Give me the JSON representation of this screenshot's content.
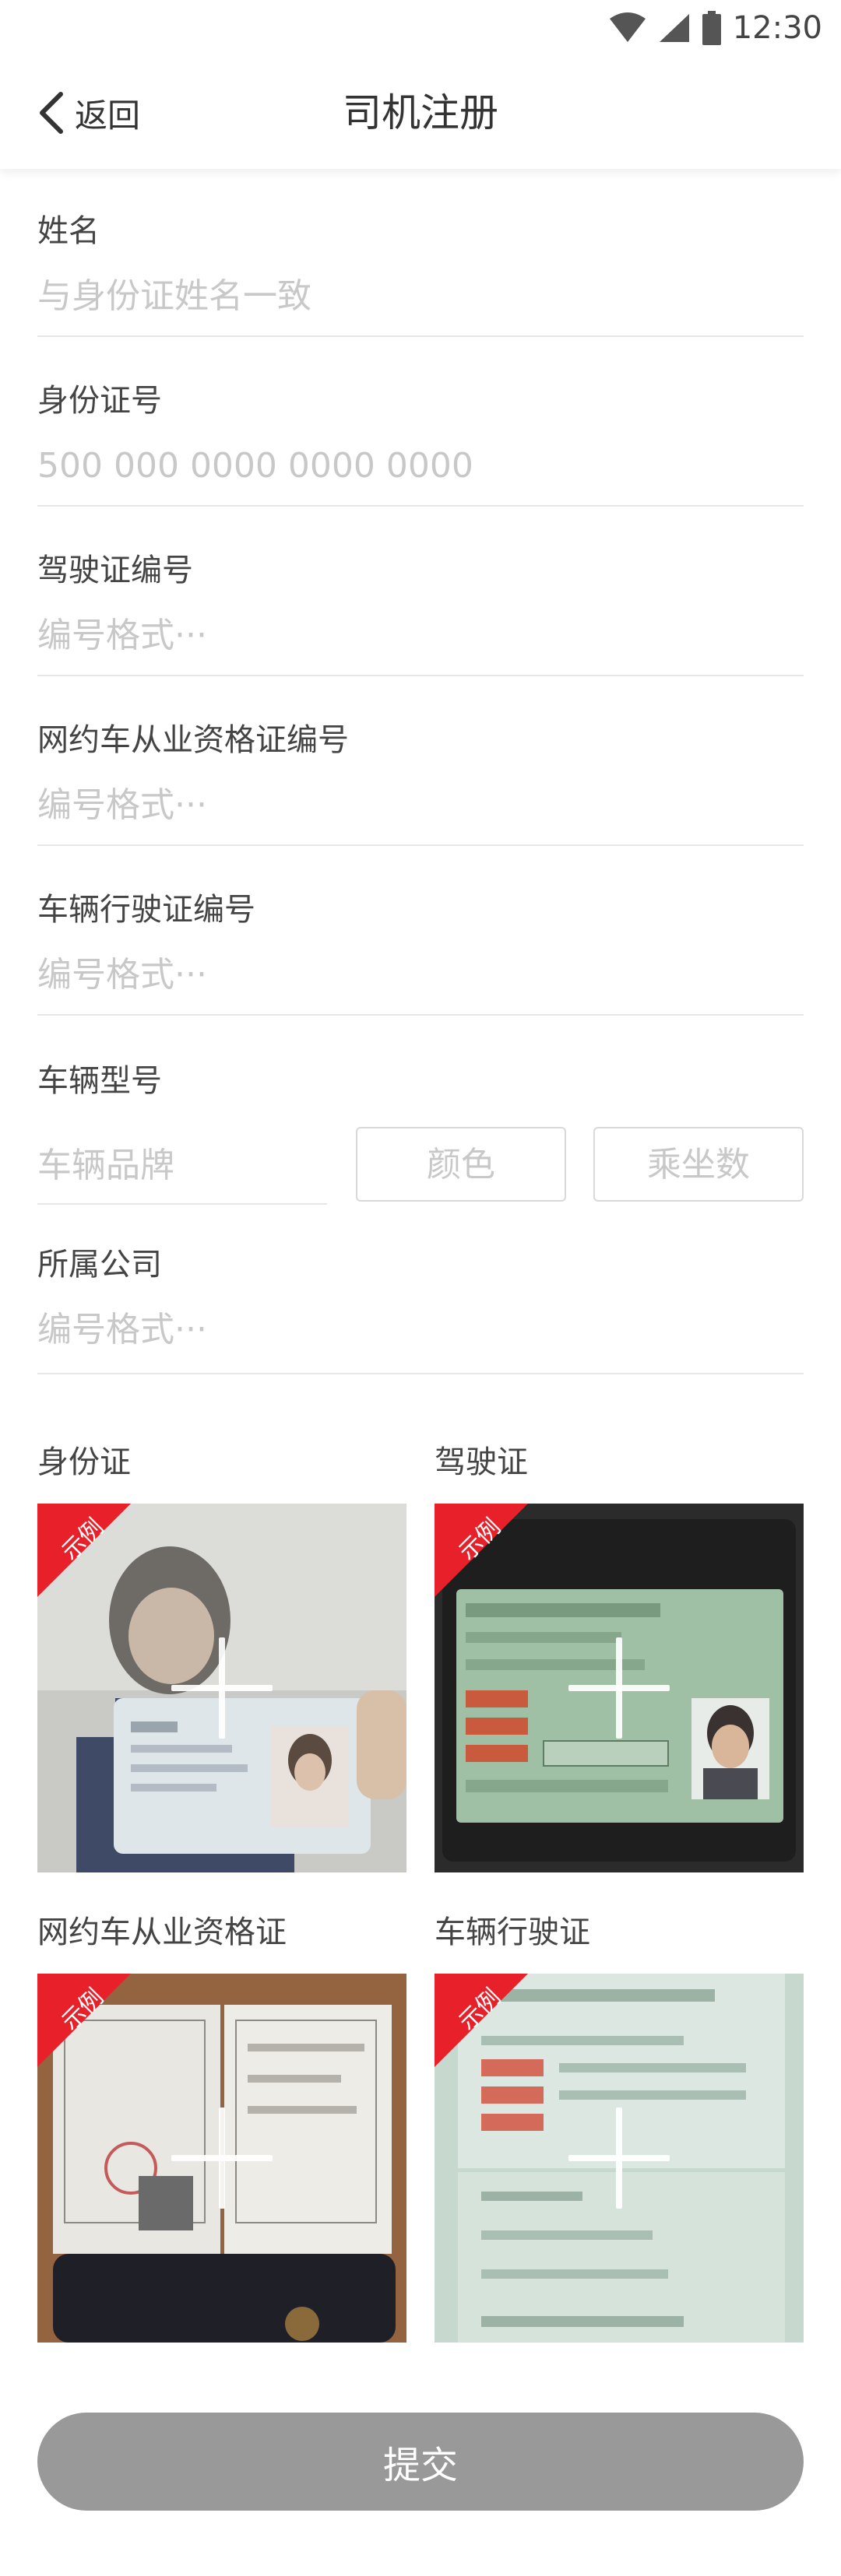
{
  "status_bar": {
    "time": "12:30"
  },
  "header": {
    "back_label": "返回",
    "title": "司机注册"
  },
  "form": {
    "name": {
      "label": "姓名",
      "placeholder": "与身份证姓名一致"
    },
    "id_number": {
      "label": "身份证号",
      "placeholder": "500 000 0000 0000 0000"
    },
    "license_number": {
      "label": "驾驶证编号",
      "placeholder": "编号格式···"
    },
    "ride_hailing_cert": {
      "label": "网约车从业资格证编号",
      "placeholder": "编号格式···"
    },
    "vehicle_license": {
      "label": "车辆行驶证编号",
      "placeholder": "编号格式···"
    },
    "vehicle_model": {
      "label": "车辆型号",
      "brand_placeholder": "车辆品牌",
      "color_placeholder": "颜色",
      "seats_placeholder": "乘坐数"
    },
    "company": {
      "label": "所属公司",
      "placeholder": "编号格式···"
    }
  },
  "uploads": {
    "sample_tag": "示例",
    "items": [
      {
        "label": "身份证"
      },
      {
        "label": "驾驶证"
      },
      {
        "label": "网约车从业资格证"
      },
      {
        "label": "车辆行驶证"
      }
    ]
  },
  "submit_label": "提交",
  "colors": {
    "sample_ribbon": "#e8202a",
    "submit_disabled": "#999999"
  }
}
